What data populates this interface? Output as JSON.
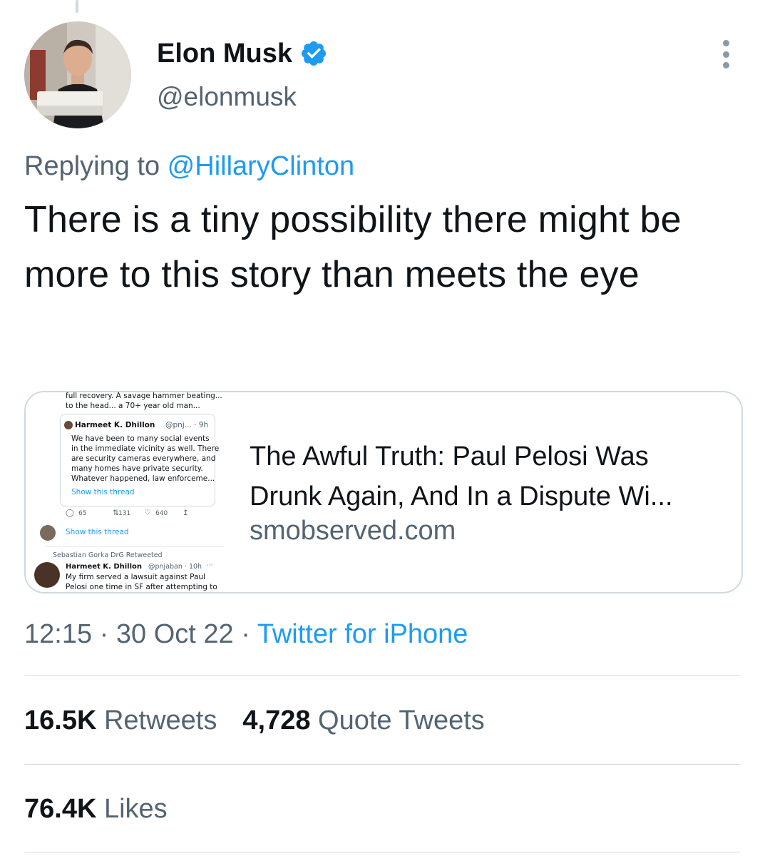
{
  "author": {
    "name": "Elon Musk",
    "handle": "@elonmusk"
  },
  "reply_context": {
    "prefix": "Replying to ",
    "user": "@HillaryClinton"
  },
  "tweet": {
    "text": "There is a tiny possibility there might be more to this story than meets the eye"
  },
  "card": {
    "title": "The Awful Truth: Paul Pelosi Was Drunk Again, And In a Dispute Wi...",
    "domain": "smobserved.com",
    "thumbnail": {
      "line1": "full recovery. A savage hammer beating...",
      "line2": "to the head... a 70+ year old man...",
      "quote_name": "Harmeet K. Dhillon",
      "quote_handle": "@pnj... · 9h",
      "quote_l1": "We have been to many social events",
      "quote_l2": "in the immediate vicinity as well. There",
      "quote_l3": "are security cameras everywhere, and",
      "quote_l4": "many homes have private security.",
      "quote_l5": "Whatever happened, law enforceme...",
      "quote_show": "Show this thread",
      "replies": "65",
      "retweets": "131",
      "likes": "640",
      "show_thread": "Show this thread",
      "retweeted_by": "Sebastian Gorka DrG Retweeted",
      "rt_name": "Harmeet K. Dhillon",
      "rt_handle": "@pnjaban · 10h",
      "rt_more": "···",
      "rt_l1": "My firm served a lawsuit against Paul",
      "rt_l2": "Pelosi one time in SF after attempting to"
    }
  },
  "meta": {
    "time": "12:15",
    "sep1": " · ",
    "date": "30 Oct 22",
    "sep2": " · ",
    "source": "Twitter for iPhone"
  },
  "stats": {
    "retweets_count": "16.5K",
    "retweets_label": " Retweets",
    "quotes_count": "4,728",
    "quotes_label": " Quote Tweets",
    "likes_count": "76.4K",
    "likes_label": " Likes"
  },
  "colors": {
    "accent": "#1d9bf0",
    "text": "#0f1419",
    "secondary": "#536471",
    "border": "#cfd9de"
  }
}
